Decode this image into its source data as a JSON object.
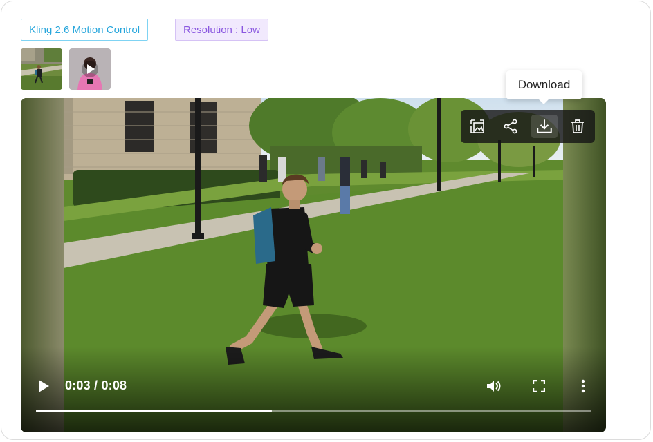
{
  "tags": {
    "model": "Kling 2.6 Motion Control",
    "resolution": "Resolution : Low"
  },
  "thumbnails": [
    {
      "icon": "image-thumbnail"
    },
    {
      "icon": "video-thumbnail-play-icon"
    }
  ],
  "toolbar": {
    "buttons": [
      {
        "name": "reference-image-icon"
      },
      {
        "name": "share-icon"
      },
      {
        "name": "download-icon"
      },
      {
        "name": "delete-icon"
      }
    ],
    "tooltip": "Download"
  },
  "player": {
    "current_time": "0:03",
    "duration": "0:08",
    "time_display": "0:03 / 0:08",
    "progress": 0.425
  },
  "colors": {
    "model_tag": "#27a6dc",
    "resolution_tag": "#8a57e0",
    "resolution_tag_bg": "#f1e9fd"
  }
}
